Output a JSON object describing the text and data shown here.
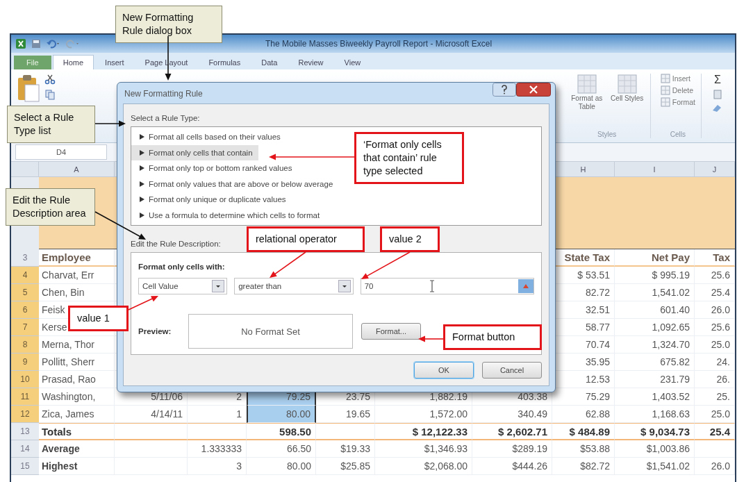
{
  "callouts": [
    {
      "kind": "note",
      "text": "New Formatting Rule dialog box"
    },
    {
      "kind": "note",
      "text": "Select a Rule Type list"
    },
    {
      "kind": "highlight",
      "text": "‘Format only cells that contain’ rule type selected"
    },
    {
      "kind": "note",
      "text": "Edit the Rule Description area"
    },
    {
      "kind": "highlight",
      "text": "relational operator"
    },
    {
      "kind": "highlight",
      "text": "value 2"
    },
    {
      "kind": "highlight",
      "text": "value 1"
    },
    {
      "kind": "highlight",
      "text": "Format button"
    }
  ],
  "window": {
    "title": "The Mobile Masses Biweekly Payroll Report - Microsoft Excel",
    "tabs": [
      {
        "label": "File",
        "kind": "file",
        "selected": false
      },
      {
        "label": "Home",
        "kind": "tab",
        "selected": true
      },
      {
        "label": "Insert",
        "kind": "tab",
        "selected": false
      },
      {
        "label": "Page Layout",
        "kind": "tab",
        "selected": false
      },
      {
        "label": "Formulas",
        "kind": "tab",
        "selected": false
      },
      {
        "label": "Data",
        "kind": "tab",
        "selected": false
      },
      {
        "label": "Review",
        "kind": "tab",
        "selected": false
      },
      {
        "label": "View",
        "kind": "tab",
        "selected": false
      }
    ]
  },
  "ribbon": {
    "styles": {
      "label": "Styles",
      "items": [
        "Format as Table",
        "Cell Styles"
      ]
    },
    "cells": {
      "label": "Cells",
      "items": [
        "Insert",
        "Delete",
        "Format"
      ]
    },
    "sum": "Σ"
  },
  "name_box": "D4",
  "sheet": {
    "column_headers": {
      "A": "A",
      "H": "H",
      "I": "I",
      "J": "J"
    },
    "rows": [
      {
        "num": "3",
        "kind": "header",
        "d_selected": false,
        "cells": {
          "A": "Employee",
          "H": "State Tax",
          "I": "Net Pay",
          "J": "Tax"
        }
      },
      {
        "num": "4",
        "kind": "data",
        "d_selected": true,
        "cells": {
          "A": "Charvat, Err",
          "H": "$   53.51",
          "I": "$      995.19",
          "J": "25.6"
        }
      },
      {
        "num": "5",
        "kind": "data",
        "d_selected": true,
        "cells": {
          "A": "Chen, Bin",
          "H": "82.72",
          "I": "1,541.02",
          "J": "25.4"
        }
      },
      {
        "num": "6",
        "kind": "data",
        "d_selected": true,
        "cells": {
          "A": "Feisk",
          "H": "32.51",
          "I": "601.40",
          "J": "26.0"
        }
      },
      {
        "num": "7",
        "kind": "data",
        "d_selected": true,
        "cells": {
          "A": "Kerse",
          "H": "58.77",
          "I": "1,092.65",
          "J": "25.6"
        }
      },
      {
        "num": "8",
        "kind": "data",
        "d_selected": true,
        "cells": {
          "A": "Merna, Thor",
          "H": "70.74",
          "I": "1,324.70",
          "J": "25.0"
        }
      },
      {
        "num": "9",
        "kind": "data",
        "d_selected": true,
        "cells": {
          "A": "Pollitt, Sherr",
          "H": "35.95",
          "I": "675.82",
          "J": "24."
        }
      },
      {
        "num": "10",
        "kind": "data",
        "d_selected": true,
        "cells": {
          "A": "Prasad, Rao",
          "H": "12.53",
          "I": "231.79",
          "J": "26."
        }
      },
      {
        "num": "11",
        "kind": "data",
        "d_selected": true,
        "cells": {
          "A": "Washington,",
          "B": "5/11/06",
          "C": "2",
          "D": "79.25",
          "E": "23.75",
          "F": "1,882.19",
          "G": "403.38",
          "H": "75.29",
          "I": "1,403.52",
          "J": "25."
        }
      },
      {
        "num": "12",
        "kind": "data",
        "d_selected": true,
        "cells": {
          "A": "Zica, James",
          "B": "4/14/11",
          "C": "1",
          "D": "80.00",
          "E": "19.65",
          "F": "1,572.00",
          "G": "340.49",
          "H": "62.88",
          "I": "1,168.63",
          "J": "25.0"
        }
      },
      {
        "num": "13",
        "kind": "total",
        "d_selected": false,
        "cells": {
          "A": "Totals",
          "D": "598.50",
          "F": "$ 12,122.33",
          "G": "$ 2,602.71",
          "H": "$ 484.89",
          "I": "$ 9,034.73",
          "J": "25.4"
        }
      },
      {
        "num": "14",
        "kind": "stat",
        "d_selected": false,
        "cells": {
          "A": "Average",
          "C": "1.333333",
          "D": "66.50",
          "E": "$19.33",
          "F": "$1,346.93",
          "G": "$289.19",
          "H": "$53.88",
          "I": "$1,003.86"
        }
      },
      {
        "num": "15",
        "kind": "stat",
        "d_selected": false,
        "cells": {
          "A": "Highest",
          "C": "3",
          "D": "80.00",
          "E": "$25.85",
          "F": "$2,068.00",
          "G": "$444.26",
          "H": "$82.72",
          "I": "$1,541.02",
          "J": "26.0"
        }
      }
    ]
  },
  "dialog": {
    "title": "New Formatting Rule",
    "rule_type_label": "Select a Rule Type:",
    "rule_types": [
      {
        "label": "Format all cells based on their values",
        "selected": false
      },
      {
        "label": "Format only cells that contain",
        "selected": true
      },
      {
        "label": "Format only top or bottom ranked values",
        "selected": false
      },
      {
        "label": "Format only values that are above or below average",
        "selected": false
      },
      {
        "label": "Format only unique or duplicate values",
        "selected": false
      },
      {
        "label": "Use a formula to determine which cells to format",
        "selected": false
      }
    ],
    "description_label": "Edit the Rule Description:",
    "condition_label": "Format only cells with:",
    "value1": "Cell Value",
    "operator": "greater than",
    "value2": "70",
    "preview_label": "Preview:",
    "preview": "No Format Set",
    "format_button": "Format...",
    "ok": "OK",
    "cancel": "Cancel"
  }
}
